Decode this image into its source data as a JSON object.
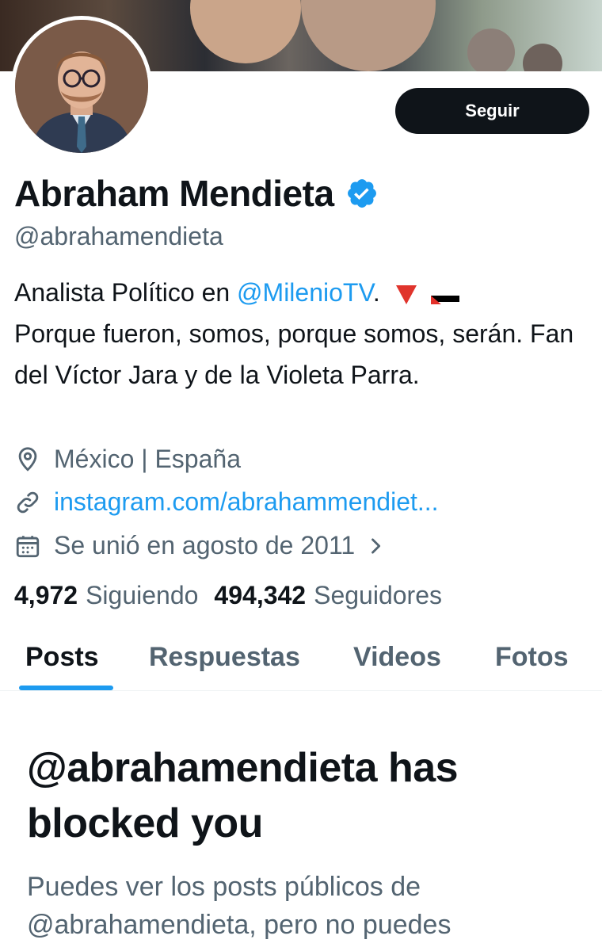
{
  "profile": {
    "name": "Abraham Mendieta",
    "handle": "@abrahamendieta",
    "follow_label": "Seguir",
    "bio_prefix": "Analista Político en ",
    "bio_mention": "@MilenioTV",
    "bio_suffix": ".",
    "bio_rest": "Porque fueron, somos, porque somos, serán. Fan del Víctor Jara y de la Violeta Parra.",
    "location": "México | España",
    "website": "instagram.com/abrahammendiet...",
    "joined": "Se unió en agosto de 2011"
  },
  "stats": {
    "following_count": "4,972",
    "following_label": "Siguiendo",
    "followers_count": "494,342",
    "followers_label": "Seguidores"
  },
  "tabs": [
    {
      "label": "Posts",
      "active": true
    },
    {
      "label": "Respuestas",
      "active": false
    },
    {
      "label": "Videos",
      "active": false
    },
    {
      "label": "Fotos",
      "active": false
    }
  ],
  "blocked": {
    "title": "@abrahamendieta has blocked you",
    "message": "Puedes ver los posts públicos de @abrahamendieta, pero no puedes"
  },
  "icons": {
    "verified": "verified-badge-icon",
    "location": "location-pin-icon",
    "link": "link-icon",
    "calendar": "calendar-icon",
    "chevron": "chevron-right-icon"
  },
  "colors": {
    "accent": "#1d9bf0",
    "text": "#0f1419",
    "secondary": "#536471",
    "button": "#0f1419"
  }
}
